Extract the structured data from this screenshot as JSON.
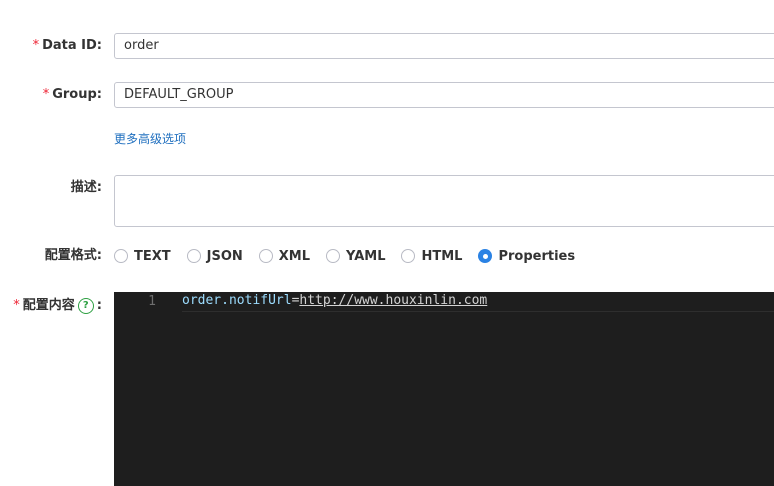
{
  "form": {
    "data_id": {
      "required_mark": "*",
      "label": "Data ID:",
      "value": "order"
    },
    "group": {
      "required_mark": "*",
      "label": "Group:",
      "value": "DEFAULT_GROUP"
    },
    "advanced_link": "更多高级选项",
    "description": {
      "label": "描述:",
      "value": ""
    },
    "format": {
      "label": "配置格式:",
      "options": [
        "TEXT",
        "JSON",
        "XML",
        "YAML",
        "HTML",
        "Properties"
      ],
      "selected": "Properties"
    },
    "content": {
      "required_mark": "*",
      "label": "配置内容",
      "help_icon": "?",
      "label_suffix": ":",
      "editor": {
        "line_number": "1",
        "key": "order.notifUrl",
        "equals": "=",
        "value": "http://www.houxinlin.com"
      }
    }
  },
  "colors": {
    "accent": "#2a82e4",
    "required": "#ee2233",
    "link": "#1f6fbf",
    "editor_bg": "#1e1e1e",
    "help_icon": "#2ea043"
  }
}
